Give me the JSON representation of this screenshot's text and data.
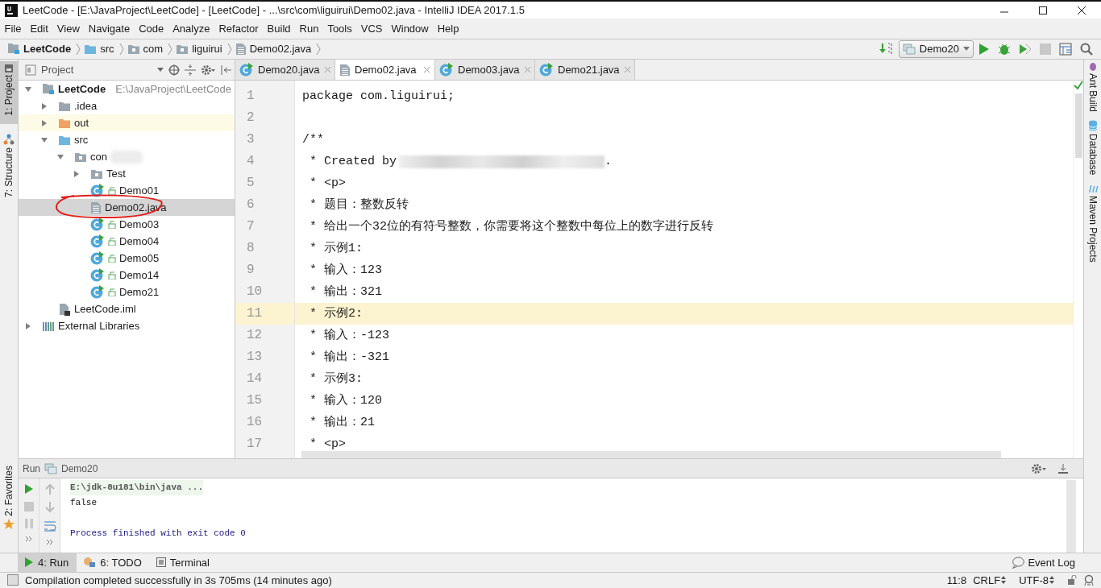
{
  "window": {
    "title": "LeetCode - [E:\\JavaProject\\LeetCode] - [LeetCode] - ...\\src\\com\\liguirui\\Demo02.java - IntelliJ IDEA 2017.1.5"
  },
  "menu": [
    "File",
    "Edit",
    "View",
    "Navigate",
    "Code",
    "Analyze",
    "Refactor",
    "Build",
    "Run",
    "Tools",
    "VCS",
    "Window",
    "Help"
  ],
  "breadcrumb": [
    {
      "label": "LeetCode",
      "kind": "module"
    },
    {
      "label": "src",
      "kind": "source"
    },
    {
      "label": "com",
      "kind": "package"
    },
    {
      "label": "liguirui",
      "kind": "package"
    },
    {
      "label": "Demo02.java",
      "kind": "file"
    }
  ],
  "run_config": {
    "label": "Demo20"
  },
  "left_stripe": [
    {
      "label": "1: Project",
      "selected": true
    },
    {
      "label": "7: Structure",
      "selected": false
    },
    {
      "label": "2: Favorites",
      "selected": false
    }
  ],
  "right_stripe": [
    "Ant Build",
    "Database",
    "Maven Projects"
  ],
  "project_panel": {
    "title": "Project"
  },
  "tree": [
    {
      "label": "LeetCode",
      "detail": "E:\\JavaProject\\LeetCode",
      "kind": "module",
      "expanded": true,
      "selected": false,
      "children": [
        {
          "label": ".idea",
          "kind": "folder",
          "expanded": false,
          "selected": false
        },
        {
          "label": "out",
          "kind": "excluded",
          "expanded": false,
          "selected": false
        },
        {
          "label": "src",
          "kind": "source",
          "expanded": true,
          "selected": false,
          "children": [
            {
              "label": "con",
              "kind": "package",
              "expanded": true,
              "redacted": true,
              "selected": false,
              "children": [
                {
                  "label": "Test",
                  "kind": "package",
                  "expanded": false,
                  "selected": false
                },
                {
                  "label": "Demo01",
                  "kind": "class",
                  "selected": false
                },
                {
                  "label": "Demo02.java",
                  "kind": "file",
                  "selected": true,
                  "circled": true
                },
                {
                  "label": "Demo03",
                  "kind": "class",
                  "selected": false
                },
                {
                  "label": "Demo04",
                  "kind": "class",
                  "selected": false
                },
                {
                  "label": "Demo05",
                  "kind": "class",
                  "selected": false
                },
                {
                  "label": "Demo14",
                  "kind": "class",
                  "selected": false
                },
                {
                  "label": "Demo21",
                  "kind": "class",
                  "selected": false
                }
              ]
            }
          ]
        },
        {
          "label": "LeetCode.iml",
          "kind": "iml",
          "selected": false
        }
      ]
    },
    {
      "label": "External Libraries",
      "kind": "libraries",
      "expanded": false,
      "selected": false
    }
  ],
  "editor_tabs": [
    {
      "label": "Demo20.java",
      "kind": "class",
      "selected": false
    },
    {
      "label": "Demo02.java",
      "kind": "file",
      "selected": true
    },
    {
      "label": "Demo03.java",
      "kind": "class",
      "selected": false
    },
    {
      "label": "Demo21.java",
      "kind": "class",
      "selected": false
    }
  ],
  "code": [
    {
      "number": "1",
      "text": "package com.liguirui;",
      "current": false
    },
    {
      "number": "2",
      "current": false
    },
    {
      "number": "3",
      "text": "/**",
      "current": false
    },
    {
      "number": "4",
      "text": " * Created by",
      "redacted": true,
      "text_after": ".",
      "current": false
    },
    {
      "number": "5",
      "text": " * <p>",
      "current": false
    },
    {
      "number": "6",
      "text": " * 题目：整数反转",
      "current": false
    },
    {
      "number": "7",
      "text": " * 给出一个32位的有符号整数，你需要将这个整数中每位上的数字进行反转",
      "current": false
    },
    {
      "number": "8",
      "text": " * 示例1:",
      "current": false
    },
    {
      "number": "9",
      "text": " * 输入：123",
      "current": false
    },
    {
      "number": "10",
      "text": " * 输出：321",
      "current": false
    },
    {
      "number": "11",
      "text": " * 示例2:",
      "current": true
    },
    {
      "number": "12",
      "text": " * 输入：-123",
      "current": false
    },
    {
      "number": "13",
      "text": " * 输出：-321",
      "current": false
    },
    {
      "number": "14",
      "text": " * 示例3:",
      "current": false
    },
    {
      "number": "15",
      "text": " * 输入：120",
      "current": false
    },
    {
      "number": "16",
      "text": " * 输出：21",
      "current": false
    },
    {
      "number": "17",
      "text": " * <p>",
      "current": false
    }
  ],
  "run_panel": {
    "title": "Run",
    "config": "Demo20",
    "console": [
      {
        "kind": "command",
        "text": "E:\\jdk-8u181\\bin\\java ..."
      },
      {
        "kind": "output",
        "text": "false"
      },
      {
        "kind": "system",
        "text": "Process finished with exit code 0"
      }
    ]
  },
  "bottom_tabs": [
    {
      "label": "4: Run",
      "kind": "run",
      "selected": true
    },
    {
      "label": "6: TODO",
      "kind": "todo",
      "selected": false
    },
    {
      "label": "Terminal",
      "kind": "terminal",
      "selected": false
    }
  ],
  "event_log": "Event Log",
  "status_bar": {
    "message": "Compilation completed successfully in 3s 705ms (14 minutes ago)",
    "position": "11:8",
    "line_separator": "CRLF",
    "encoding": "UTF-8"
  }
}
